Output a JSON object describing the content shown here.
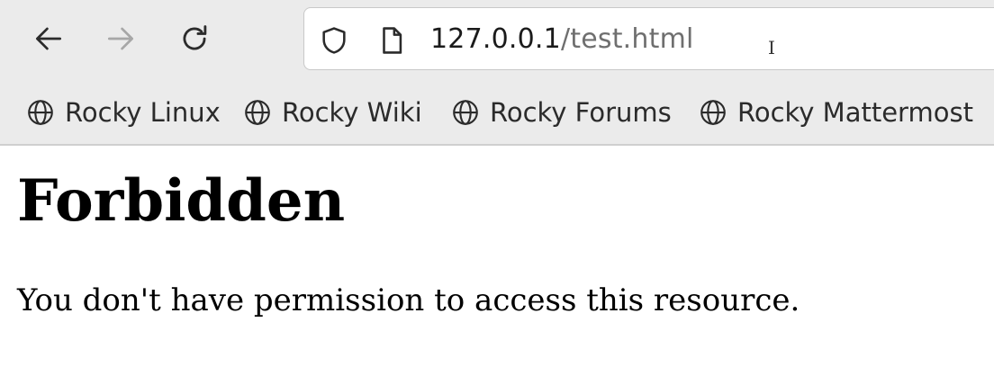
{
  "toolbar": {
    "back_icon": "arrow-left-icon",
    "forward_icon": "arrow-right-icon",
    "reload_icon": "reload-icon"
  },
  "url_bar": {
    "host": "127.0.0.1",
    "path": "/test.html",
    "security_icon": "shield-icon",
    "page_icon": "page-icon"
  },
  "bookmarks": [
    {
      "label": "Rocky Linux",
      "icon": "globe-icon"
    },
    {
      "label": "Rocky Wiki",
      "icon": "globe-icon"
    },
    {
      "label": "Rocky Forums",
      "icon": "globe-icon"
    },
    {
      "label": "Rocky Mattermost",
      "icon": "globe-icon"
    }
  ],
  "page": {
    "heading": "Forbidden",
    "message": "You don't have permission to access this resource."
  },
  "colors": {
    "chrome_bg": "#ebebeb",
    "url_path": "#6f6f6f",
    "disabled_icon": "#a7a7a7"
  }
}
